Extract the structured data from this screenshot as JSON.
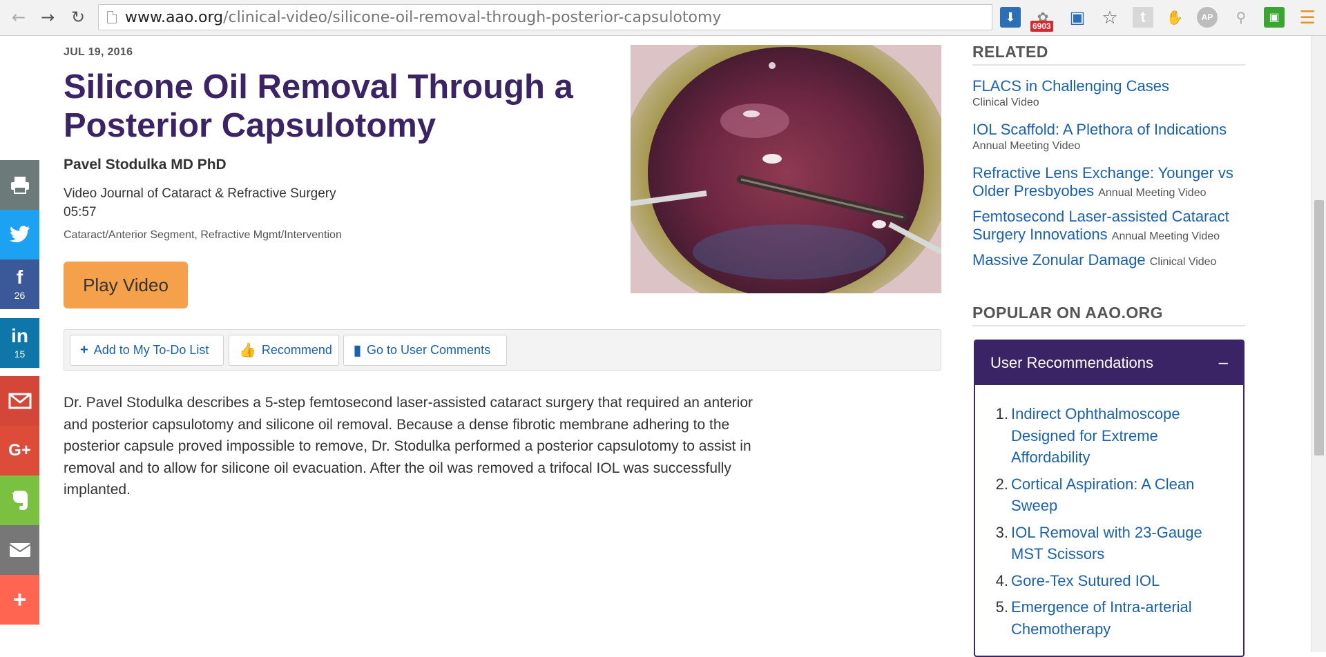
{
  "browser": {
    "url_host": "www.aao.org",
    "url_path": "/clinical-video/silicone-oil-removal-through-posterior-capsulotomy",
    "badge_count": "6903",
    "ap_label": "AP",
    "t_label": "t"
  },
  "share": {
    "facebook_count": "26",
    "linkedin_count": "15"
  },
  "article": {
    "date": "JUL 19, 2016",
    "title": "Silicone Oil Removal Through a Posterior Capsulotomy",
    "author": "Pavel Stodulka MD PhD",
    "journal": "Video Journal of Cataract & Refractive Surgery",
    "duration": "05:57",
    "topics": "Cataract/Anterior Segment, Refractive Mgmt/Intervention",
    "play_label": "Play Video",
    "description": "Dr. Pavel Stodulka describes a 5-step femtosecond laser-assisted cataract surgery that required an anterior and posterior capsulotomy and silicone oil removal. Because a dense fibrotic membrane adhering to the posterior capsule proved impossible to remove, Dr. Stodulka performed a posterior capsulotomy to assist in removal and to allow for silicone oil evacuation. After the oil was removed a trifocal IOL was successfully implanted."
  },
  "actions": {
    "todo": "Add to My To-Do List",
    "recommend": "Recommend",
    "comments": "Go to User Comments"
  },
  "sidebar": {
    "related_heading": "RELATED",
    "related": [
      {
        "title": "FLACS in Challenging Cases",
        "type": "Clinical Video"
      },
      {
        "title": "IOL Scaffold: A Plethora of Indications",
        "type": "Annual Meeting Video"
      },
      {
        "title": "Refractive Lens Exchange: Younger vs Older Presbyobes",
        "type": "Annual Meeting Video"
      },
      {
        "title": "Femtosecond Laser-assisted Cataract Surgery Innovations",
        "type": "Annual Meeting Video"
      },
      {
        "title": "Massive Zonular Damage",
        "type": "Clinical Video"
      }
    ],
    "popular_heading": "POPULAR ON AAO.ORG",
    "user_rec_heading": "User Recommendations",
    "user_rec_collapse": "–",
    "user_recs": [
      {
        "num": "1.",
        "title": "Indirect Ophthalmoscope Designed for Extreme Affordability"
      },
      {
        "num": "2.",
        "title": "Cortical Aspiration: A Clean Sweep"
      },
      {
        "num": "3.",
        "title": "IOL Removal with 23-Gauge MST Scissors"
      },
      {
        "num": "4.",
        "title": "Gore-Tex Sutured IOL"
      },
      {
        "num": "5.",
        "title": "Emergence of Intra-arterial Chemotherapy"
      }
    ]
  },
  "colors": {
    "brand_purple": "#3b2466",
    "link_blue": "#1a61b2",
    "play_orange": "#f5a04a"
  }
}
